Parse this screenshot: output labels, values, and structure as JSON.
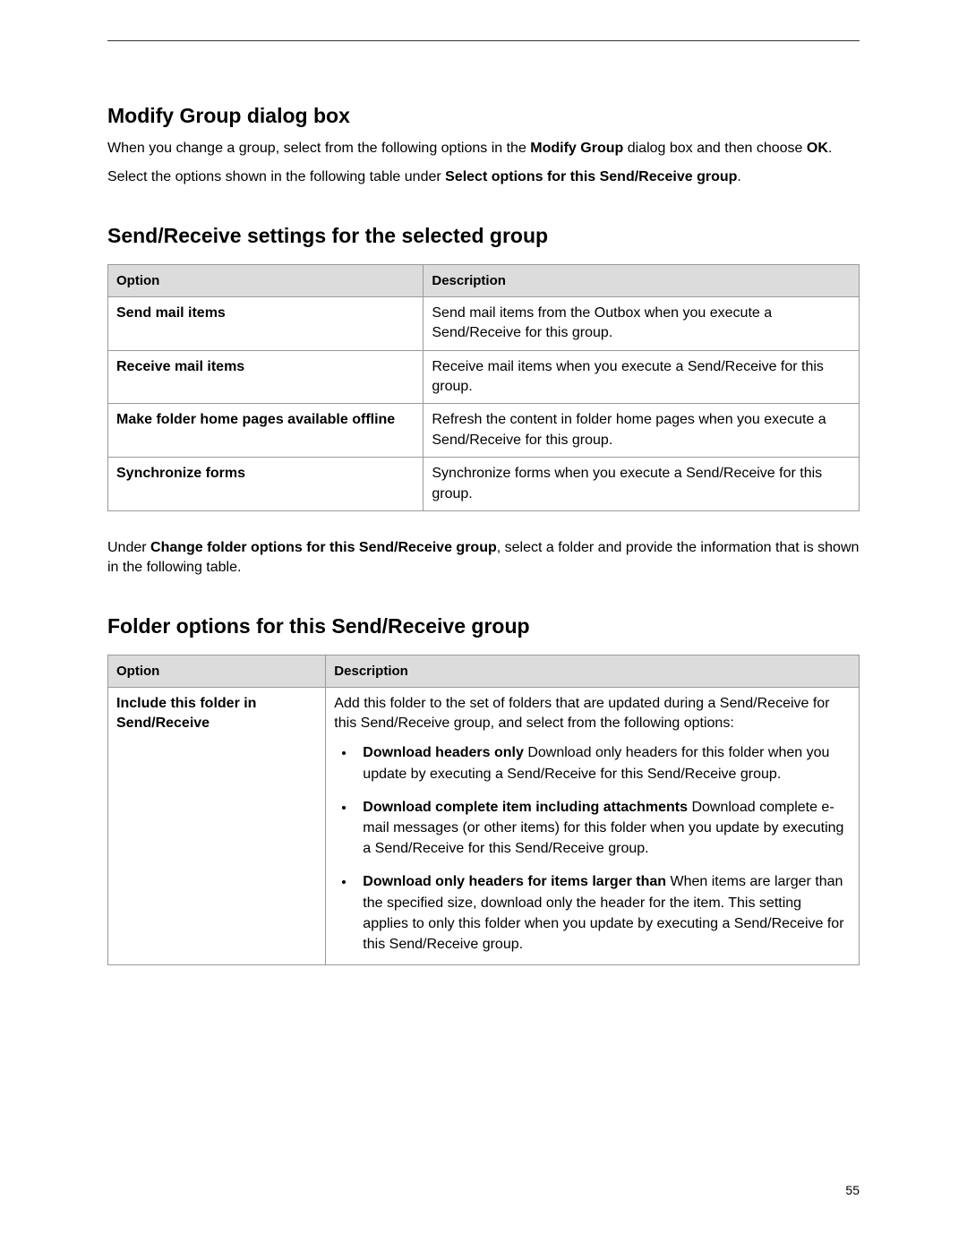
{
  "heading1": "Modify Group dialog box",
  "para1_before": "When you change a group, select from the following options in the ",
  "para1_bold1": "Modify Group",
  "para1_mid": " dialog box and then choose ",
  "para1_bold2": "OK",
  "para1_after": ".",
  "para2_before": "Select the options shown in the following table under ",
  "para2_bold": "Select options for this Send/Receive group",
  "para2_after": ".",
  "heading2": "Send/Receive settings for the selected group",
  "table1": {
    "head_option": "Option",
    "head_desc": "Description",
    "rows": [
      {
        "option": "Send mail items",
        "desc": "Send mail items from the Outbox when you execute a Send/Receive for this group."
      },
      {
        "option": "Receive mail items",
        "desc": "Receive mail items when you execute a Send/Receive for this group."
      },
      {
        "option": "Make folder home pages available offline",
        "desc": "Refresh the content in folder home pages when you execute a Send/Receive for this group."
      },
      {
        "option": "Synchronize forms",
        "desc": "Synchronize forms when you execute a Send/Receive for this group."
      }
    ]
  },
  "para3_before": "Under ",
  "para3_bold": "Change folder options for this Send/Receive group",
  "para3_after": ", select a folder and provide the information that is shown in the following table.",
  "heading3": "Folder options for this Send/Receive group",
  "table2": {
    "head_option": "Option",
    "head_desc": "Description",
    "row_option": "Include this folder in Send/Receive",
    "row_desc_intro": "Add this folder to the set of folders that are updated during a Send/Receive for this Send/Receive group, and select from the following options:",
    "bullets": [
      {
        "bold": "Download headers only",
        "rest": "   Download only headers for this folder when you update by executing a Send/Receive for this Send/Receive group."
      },
      {
        "bold": "Download complete item including attachments",
        "rest": "   Download complete e-mail messages (or other items) for this folder when you update by executing a Send/Receive for this Send/Receive group."
      },
      {
        "bold": "Download only headers for items larger than",
        "rest": "   When items are larger than the specified size, download only the header for the item. This setting applies to only this folder when you update by executing a Send/Receive for this Send/Receive group."
      }
    ]
  },
  "page_number": "55"
}
